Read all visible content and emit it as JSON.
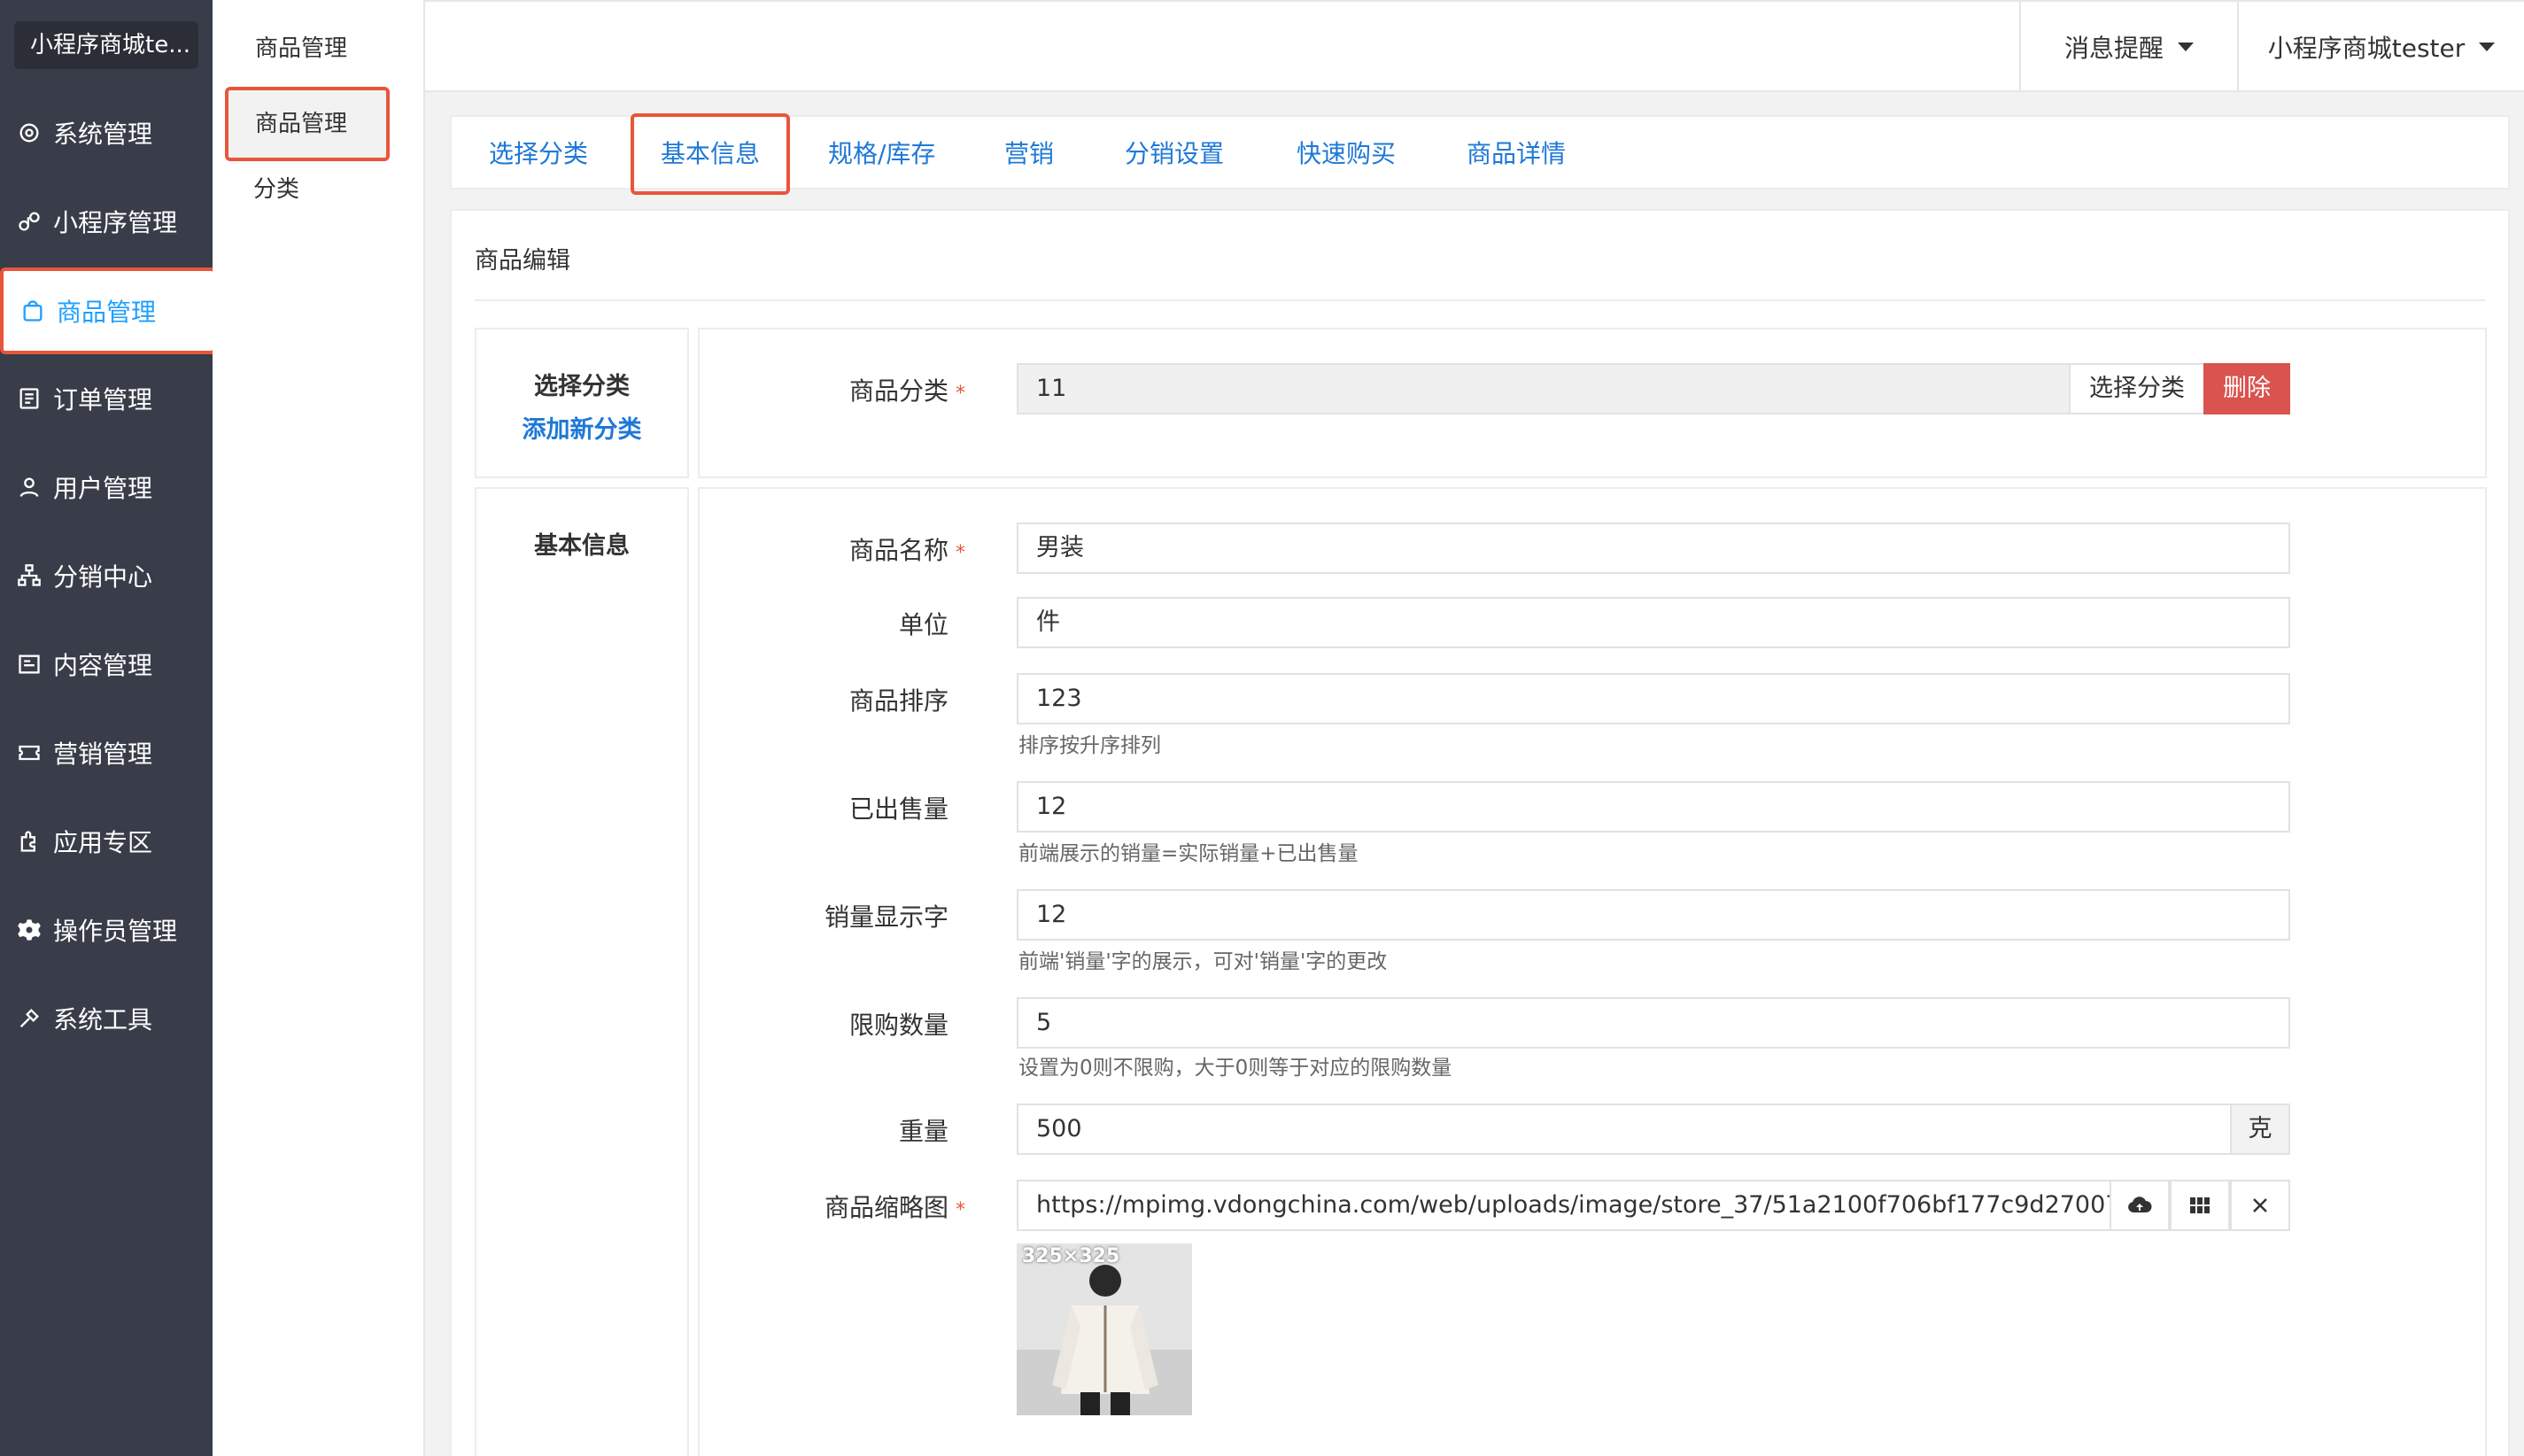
{
  "sidebar": {
    "brand": "小程序商城te...",
    "items": [
      {
        "label": "系统管理",
        "icon": "gear-outline-icon"
      },
      {
        "label": "小程序管理",
        "icon": "mini-program-icon"
      },
      {
        "label": "商品管理",
        "icon": "shopping-bag-icon",
        "active": true
      },
      {
        "label": "订单管理",
        "icon": "order-list-icon"
      },
      {
        "label": "用户管理",
        "icon": "user-icon"
      },
      {
        "label": "分销中心",
        "icon": "network-icon"
      },
      {
        "label": "内容管理",
        "icon": "content-icon"
      },
      {
        "label": "营销管理",
        "icon": "ticket-icon"
      },
      {
        "label": "应用专区",
        "icon": "app-icon"
      },
      {
        "label": "操作员管理",
        "icon": "gear-solid-icon"
      },
      {
        "label": "系统工具",
        "icon": "tools-icon"
      }
    ]
  },
  "submenu": {
    "title": "商品管理",
    "items": [
      {
        "label": "商品管理",
        "active": true
      },
      {
        "label": "分类"
      }
    ]
  },
  "header": {
    "messages": "消息提醒",
    "user": "小程序商城tester"
  },
  "tabs": [
    "选择分类",
    "基本信息",
    "规格/库存",
    "营销",
    "分销设置",
    "快速购买",
    "商品详情"
  ],
  "panel": {
    "title": "商品编辑",
    "category_section": {
      "title": "选择分类",
      "link": "添加新分类",
      "label": "商品分类",
      "value": "11",
      "select_button": "选择分类",
      "delete_button": "删除"
    },
    "basic_section": {
      "title": "基本信息",
      "name_label": "商品名称",
      "name_value": "男装",
      "unit_label": "单位",
      "unit_value": "件",
      "sort_label": "商品排序",
      "sort_value": "123",
      "sort_hint": "排序按升序排列",
      "sold_label": "已出售量",
      "sold_value": "12",
      "sold_hint": "前端展示的销量=实际销量+已出售量",
      "sales_text_label": "销量显示字",
      "sales_text_value": "12",
      "sales_text_hint": "前端'销量'字的展示，可对'销量'字的更改",
      "limit_label": "限购数量",
      "limit_value": "5",
      "limit_hint": "设置为0则不限购，大于0则等于对应的限购数量",
      "weight_label": "重量",
      "weight_value": "500",
      "weight_unit": "克",
      "thumb_label": "商品缩略图",
      "thumb_value": "https://mpimg.vdongchina.com/web/uploads/image/store_37/51a2100f706bf177c9d27007eb6f74",
      "thumb_size": "325×325"
    }
  },
  "colors": {
    "sidebar_bg": "#393d49",
    "accent_blue": "#1e78d7",
    "highlight_red": "#e9553b",
    "delete_red": "#d9534f"
  }
}
